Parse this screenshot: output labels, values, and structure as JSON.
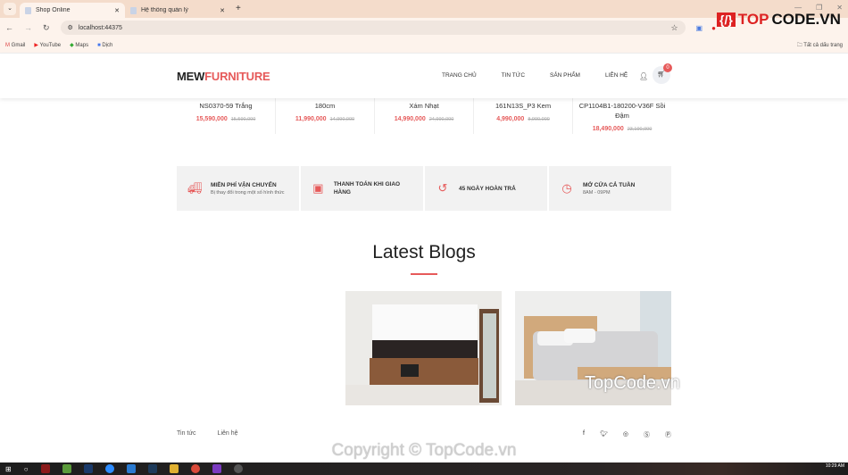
{
  "browser": {
    "tabs": [
      {
        "title": "Shop Online",
        "active": true
      },
      {
        "title": "Hệ thống quản lý",
        "active": false
      }
    ],
    "url": "localhost:44375",
    "bookmarks": [
      "Gmail",
      "YouTube",
      "Maps",
      "Dịch"
    ],
    "all_bookmarks": "Tất cả dấu trang"
  },
  "header": {
    "logo_a": "MEW",
    "logo_b": "FURNITURE",
    "nav": [
      "TRANG CHỦ",
      "TIN TỨC",
      "SẢN PHẨM",
      "LIÊN HỆ"
    ],
    "cart_count": "0",
    "accent": "#e65a5a"
  },
  "products": [
    {
      "name": "NS0370-59 Trắng",
      "price": "15,590,000",
      "old_price": "15,590,000"
    },
    {
      "name": "180cm",
      "price": "11,990,000",
      "old_price": "14,990,000"
    },
    {
      "name": "Xám Nhạt",
      "price": "14,990,000",
      "old_price": "24,990,000"
    },
    {
      "name": "161N13S_P3 Kem",
      "price": "4,990,000",
      "old_price": "8,990,000"
    },
    {
      "name": "CP1104B1-180200-V36F Sồi Đậm",
      "price": "18,490,000",
      "old_price": "23,190,000"
    }
  ],
  "features": [
    {
      "icon": "truck-icon",
      "title": "MIỄN PHÍ VẬN CHUYỂN",
      "sub": "Bị thay đổi trong một số hình thức"
    },
    {
      "icon": "money-icon",
      "title": "THANH TOÁN KHI GIAO HÀNG",
      "sub": ""
    },
    {
      "icon": "undo-icon",
      "title": "45 NGÀY HOÀN TRẢ",
      "sub": ""
    },
    {
      "icon": "clock-icon",
      "title": "MỞ CỬA CẢ TUẦN",
      "sub": "8AM - 09PM"
    }
  ],
  "blogs": {
    "title": "Latest Blogs"
  },
  "footer": {
    "links": [
      "Tin tức",
      "Liên hệ"
    ],
    "social": [
      "facebook-icon",
      "twitter-icon",
      "instagram-icon",
      "skype-icon",
      "pinterest-icon"
    ]
  },
  "watermarks": {
    "logo": "TOPCODE.VN",
    "image": "TopCode.vn",
    "copyright": "Copyright © TopCode.vn"
  },
  "taskbar": {
    "time": "10:29 AM"
  }
}
